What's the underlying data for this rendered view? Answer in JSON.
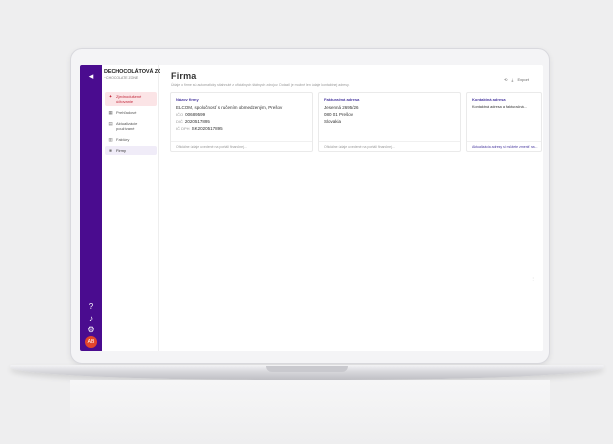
{
  "rail": {
    "avatar": "AB"
  },
  "brand": {
    "name": "DECHOCOLÁTOVÁ ZÓNA",
    "tagline": "~CHOCOLATE ZONE"
  },
  "sidebar": {
    "items": [
      {
        "label": "Zjednodušené účtovanie",
        "icon": "sparkle-icon",
        "state": "active"
      },
      {
        "label": "Prehľadové",
        "icon": "grid-icon",
        "state": "normal"
      },
      {
        "label": "Aktualizácie používané",
        "icon": "document-icon",
        "state": "normal"
      },
      {
        "label": "Faktúry",
        "icon": "invoice-icon",
        "state": "normal"
      },
      {
        "label": "Firmy",
        "icon": "briefcase-icon",
        "state": "current"
      }
    ]
  },
  "page": {
    "title": "Firma",
    "subtitle": "Údaje o firme sú automaticky stiahnuté z oficiálnych štátnych zdrojov. Dotazil je možné len údaje kontaktnej adresy.",
    "action_refresh": "⟲",
    "action_export": "Export"
  },
  "cards": [
    {
      "heading": "Názov firmy",
      "lines": [
        {
          "prefix": "",
          "text": "ELCOM, spoločnosť s ručením obmedzeným, Prešov"
        },
        {
          "prefix": "IČO",
          "text": "00689599"
        },
        {
          "prefix": "DIČ",
          "text": "2020517895"
        },
        {
          "prefix": "IČ DPH",
          "text": "SK2020517895"
        }
      ],
      "footer": "Oficiálne údaje uvedené na portáli finančnej...",
      "footer_link": false
    },
    {
      "heading": "Fakturačná adresa",
      "lines": [
        {
          "prefix": "",
          "text": "Jesenná 2695/26"
        },
        {
          "prefix": "",
          "text": "080 01 Prešov"
        },
        {
          "prefix": "",
          "text": "Slovakia"
        }
      ],
      "footer": "Oficiálne údaje uvedené na portáli finančnej...",
      "footer_link": false
    },
    {
      "heading": "Kontaktná adresa",
      "lines": [
        {
          "prefix": "",
          "text": "Kontaktná adresa a fakturačná..."
        }
      ],
      "footer": "Aktualizácia adresy si môžete zmeniť na...",
      "footer_link": true
    }
  ],
  "colors": {
    "rail": "#4a0c8f",
    "accent_red": "#c2273a",
    "heading_purple": "#4a3aa0"
  }
}
